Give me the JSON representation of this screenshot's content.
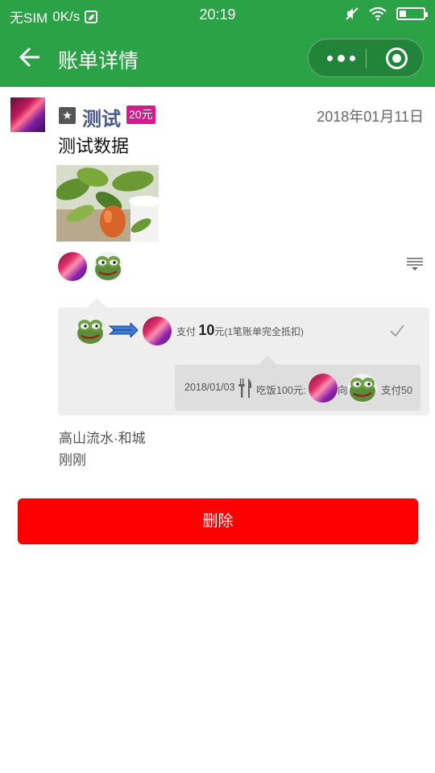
{
  "status_bar": {
    "carrier": "无SIM",
    "speed": "0K/s",
    "time": "20:19"
  },
  "nav": {
    "title": "账单详情"
  },
  "record": {
    "name": "测试",
    "amount_badge": "20元",
    "date": "2018年01月11日",
    "content": "测试数据",
    "location": "高山流水·和城",
    "time_ago": "刚刚"
  },
  "payment": {
    "pay_prefix": "支付",
    "pay_amount": "10",
    "pay_suffix": "元(1笔账单完全抵扣)"
  },
  "bill_detail": {
    "date": "2018/01/03",
    "meal": "吃饭100元:",
    "to": "向",
    "pay": "支付50"
  },
  "actions": {
    "delete_label": "删除"
  },
  "colors": {
    "header_green": "#2aa245",
    "badge_magenta": "#d41a8c",
    "name_blue": "#4a5a8a",
    "delete_red": "#ff0000"
  }
}
